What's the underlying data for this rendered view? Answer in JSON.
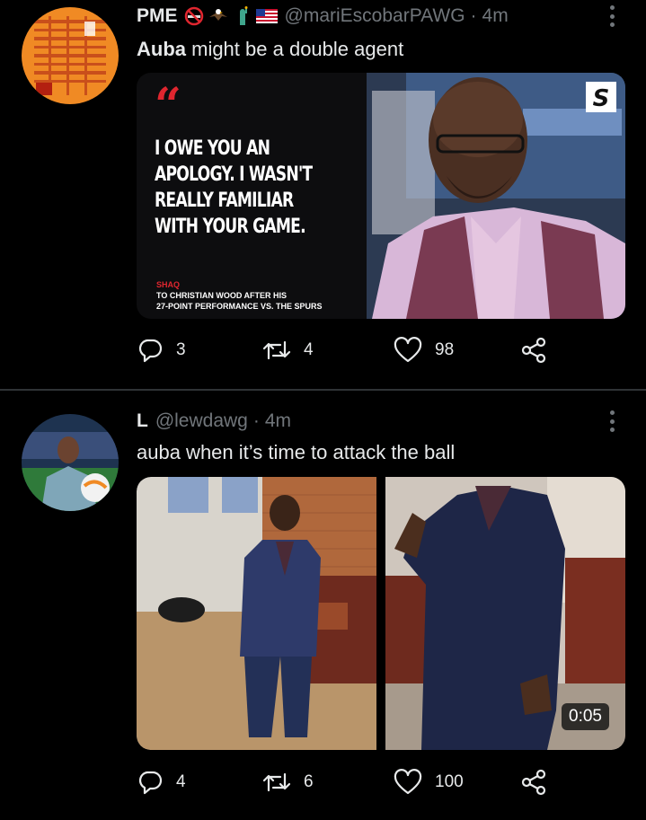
{
  "tweets": [
    {
      "name": "PME",
      "handle": "@mariEscobarPAWG",
      "separator": "·",
      "time": "4m",
      "emojis": [
        "no-smoking-emoji",
        "eagle-emoji",
        "statue-of-liberty-emoji",
        "us-flag-emoji"
      ],
      "text_bold": "Auba",
      "text_rest": " might be a double agent",
      "media": {
        "quote_lines": [
          "I OWE YOU AN",
          "APOLOGY. I WASN'T",
          "REALLY FAMILIAR",
          "WITH YOUR GAME."
        ],
        "speaker": "SHAQ",
        "caption_lines": [
          "TO CHRISTIAN WOOD AFTER HIS",
          "27-POINT PERFORMANCE VS. THE SPURS"
        ],
        "logo": "S"
      },
      "replies": "3",
      "retweets": "4",
      "likes": "98"
    },
    {
      "name": "L",
      "handle": "@lewdawg",
      "separator": "·",
      "time": "4m",
      "text_bold": "",
      "text_rest": "auba when it’s time to attack the ball",
      "media": {
        "video_time": "0:05"
      },
      "replies": "4",
      "retweets": "6",
      "likes": "100"
    }
  ],
  "colors": {
    "background": "#000000",
    "text": "#e7e9ea",
    "muted": "#71767b",
    "quote_red": "#e0262f"
  },
  "icons": [
    "reply-icon",
    "retweet-icon",
    "like-icon",
    "share-icon",
    "more-icon"
  ]
}
